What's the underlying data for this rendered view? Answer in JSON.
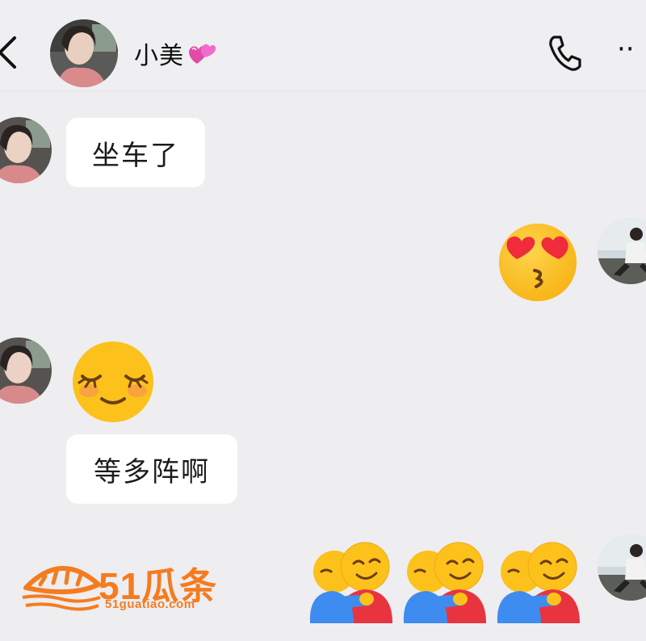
{
  "header": {
    "contact_name": "小美",
    "name_emoji_icon": "two-hearts-icon",
    "back_icon": "chevron-left-icon",
    "call_icon": "phone-icon",
    "more_icon": "more-dots-icon",
    "more_label": "··"
  },
  "messages": [
    {
      "sender": "contact",
      "type": "text",
      "text": "坐车了"
    },
    {
      "sender": "me",
      "type": "emoji",
      "emoji": "kissing-heart-eyes-emoji"
    },
    {
      "sender": "contact",
      "type": "emoji",
      "emoji": "relieved-smile-emoji"
    },
    {
      "sender": "contact",
      "type": "text",
      "text": "等多阵啊"
    },
    {
      "sender": "me",
      "type": "emoji",
      "emoji": [
        "hugging-face-emoji",
        "hugging-face-emoji",
        "hugging-face-emoji"
      ]
    }
  ],
  "watermark": {
    "brand": "51瓜条",
    "url": "51guatiao.com"
  },
  "colors": {
    "background": "#eeedf0",
    "bubble": "#ffffff",
    "watermark": "#f47c1f"
  }
}
